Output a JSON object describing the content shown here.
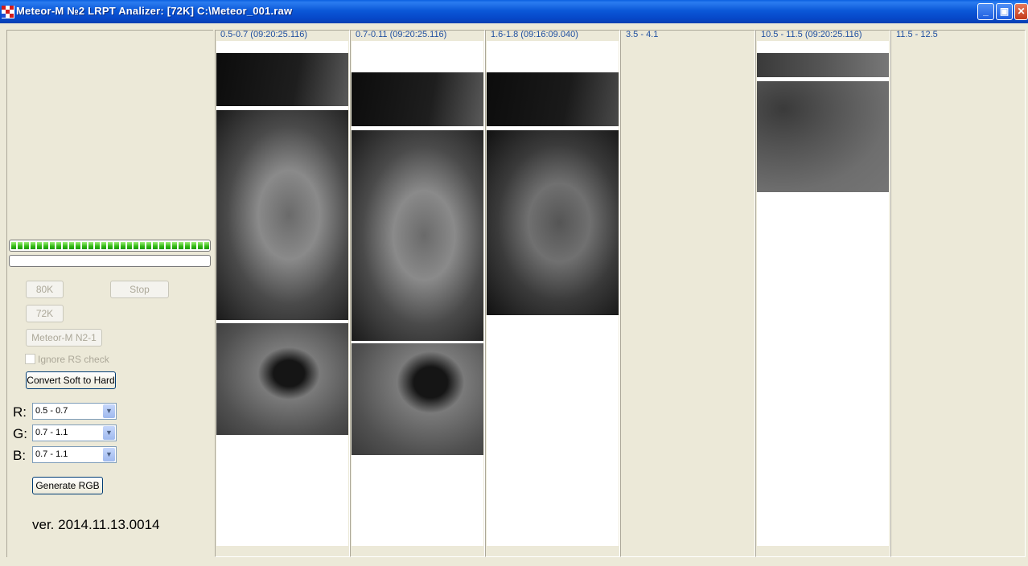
{
  "window": {
    "title": "Meteor-M №2 LRPT Analizer: [72K] C:\\Meteor_001.raw",
    "controls": {
      "minimize": "_",
      "maximize": "▣",
      "close": "✕"
    }
  },
  "left_panel": {
    "progress_main": 1.0,
    "progress_secondary": 0.0,
    "buttons": {
      "k80": "80K",
      "stop": "Stop",
      "k72": "72K",
      "meteor": "Meteor-M N2-1",
      "convert": "Convert Soft to Hard",
      "generate": "Generate RGB"
    },
    "ignore_rs_label": "Ignore RS check",
    "rgb": {
      "r_label": "R:",
      "r_value": "0.5 - 0.7",
      "g_label": "G:",
      "g_value": "0.7 - 1.1",
      "b_label": "B:",
      "b_value": "0.7 - 1.1"
    },
    "version": "ver. 2014.11.13.0014"
  },
  "channels": [
    {
      "label": "0.5-0.7 (09:20:25.116)"
    },
    {
      "label": "0.7-0.11 (09:20:25.116)"
    },
    {
      "label": "1.6-1.8 (09:16:09.040)"
    },
    {
      "label": "3.5 - 4.1"
    },
    {
      "label": "10.5 - 11.5 (09:20:25.116)"
    },
    {
      "label": "11.5 - 12.5"
    }
  ],
  "colors": {
    "accent": "#1f4fa0",
    "title_bar": "#0b58d8",
    "progress": "#32b814"
  }
}
